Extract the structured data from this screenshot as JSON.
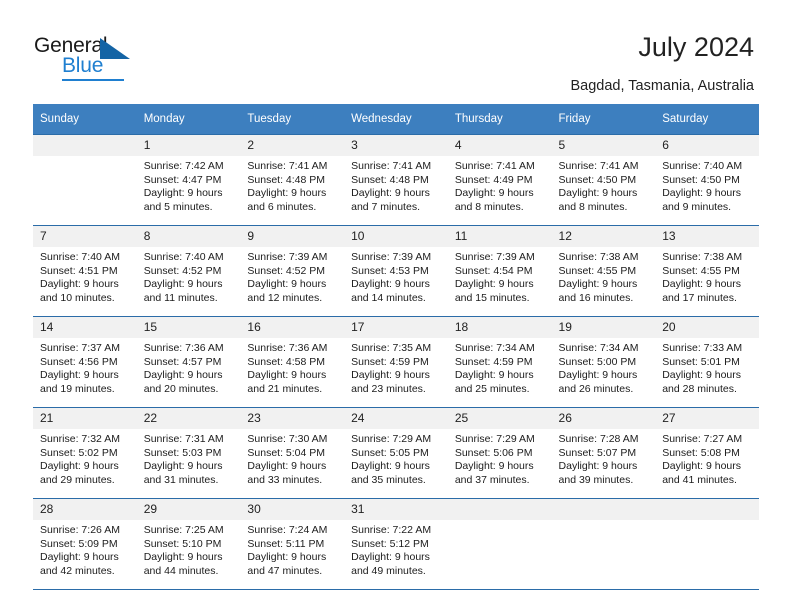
{
  "brand": {
    "name_top": "General",
    "name_bottom": "Blue",
    "accent_color": "#1f7fd0",
    "triangle_color": "#1464a5"
  },
  "header": {
    "title": "July 2024",
    "subtitle": "Bagdad, Tasmania, Australia"
  },
  "calendar": {
    "header_bg": "#3d7fbf",
    "day_band_bg": "#f1f1f1",
    "grid_line_color": "#2b6ca8",
    "weekday_headers": [
      "Sunday",
      "Monday",
      "Tuesday",
      "Wednesday",
      "Thursday",
      "Friday",
      "Saturday"
    ],
    "weeks": [
      [
        {
          "day": "",
          "sunrise": "",
          "sunset": "",
          "daylight_line1": "",
          "daylight_line2": ""
        },
        {
          "day": "1",
          "sunrise": "Sunrise: 7:42 AM",
          "sunset": "Sunset: 4:47 PM",
          "daylight_line1": "Daylight: 9 hours",
          "daylight_line2": "and 5 minutes."
        },
        {
          "day": "2",
          "sunrise": "Sunrise: 7:41 AM",
          "sunset": "Sunset: 4:48 PM",
          "daylight_line1": "Daylight: 9 hours",
          "daylight_line2": "and 6 minutes."
        },
        {
          "day": "3",
          "sunrise": "Sunrise: 7:41 AM",
          "sunset": "Sunset: 4:48 PM",
          "daylight_line1": "Daylight: 9 hours",
          "daylight_line2": "and 7 minutes."
        },
        {
          "day": "4",
          "sunrise": "Sunrise: 7:41 AM",
          "sunset": "Sunset: 4:49 PM",
          "daylight_line1": "Daylight: 9 hours",
          "daylight_line2": "and 8 minutes."
        },
        {
          "day": "5",
          "sunrise": "Sunrise: 7:41 AM",
          "sunset": "Sunset: 4:50 PM",
          "daylight_line1": "Daylight: 9 hours",
          "daylight_line2": "and 8 minutes."
        },
        {
          "day": "6",
          "sunrise": "Sunrise: 7:40 AM",
          "sunset": "Sunset: 4:50 PM",
          "daylight_line1": "Daylight: 9 hours",
          "daylight_line2": "and 9 minutes."
        }
      ],
      [
        {
          "day": "7",
          "sunrise": "Sunrise: 7:40 AM",
          "sunset": "Sunset: 4:51 PM",
          "daylight_line1": "Daylight: 9 hours",
          "daylight_line2": "and 10 minutes."
        },
        {
          "day": "8",
          "sunrise": "Sunrise: 7:40 AM",
          "sunset": "Sunset: 4:52 PM",
          "daylight_line1": "Daylight: 9 hours",
          "daylight_line2": "and 11 minutes."
        },
        {
          "day": "9",
          "sunrise": "Sunrise: 7:39 AM",
          "sunset": "Sunset: 4:52 PM",
          "daylight_line1": "Daylight: 9 hours",
          "daylight_line2": "and 12 minutes."
        },
        {
          "day": "10",
          "sunrise": "Sunrise: 7:39 AM",
          "sunset": "Sunset: 4:53 PM",
          "daylight_line1": "Daylight: 9 hours",
          "daylight_line2": "and 14 minutes."
        },
        {
          "day": "11",
          "sunrise": "Sunrise: 7:39 AM",
          "sunset": "Sunset: 4:54 PM",
          "daylight_line1": "Daylight: 9 hours",
          "daylight_line2": "and 15 minutes."
        },
        {
          "day": "12",
          "sunrise": "Sunrise: 7:38 AM",
          "sunset": "Sunset: 4:55 PM",
          "daylight_line1": "Daylight: 9 hours",
          "daylight_line2": "and 16 minutes."
        },
        {
          "day": "13",
          "sunrise": "Sunrise: 7:38 AM",
          "sunset": "Sunset: 4:55 PM",
          "daylight_line1": "Daylight: 9 hours",
          "daylight_line2": "and 17 minutes."
        }
      ],
      [
        {
          "day": "14",
          "sunrise": "Sunrise: 7:37 AM",
          "sunset": "Sunset: 4:56 PM",
          "daylight_line1": "Daylight: 9 hours",
          "daylight_line2": "and 19 minutes."
        },
        {
          "day": "15",
          "sunrise": "Sunrise: 7:36 AM",
          "sunset": "Sunset: 4:57 PM",
          "daylight_line1": "Daylight: 9 hours",
          "daylight_line2": "and 20 minutes."
        },
        {
          "day": "16",
          "sunrise": "Sunrise: 7:36 AM",
          "sunset": "Sunset: 4:58 PM",
          "daylight_line1": "Daylight: 9 hours",
          "daylight_line2": "and 21 minutes."
        },
        {
          "day": "17",
          "sunrise": "Sunrise: 7:35 AM",
          "sunset": "Sunset: 4:59 PM",
          "daylight_line1": "Daylight: 9 hours",
          "daylight_line2": "and 23 minutes."
        },
        {
          "day": "18",
          "sunrise": "Sunrise: 7:34 AM",
          "sunset": "Sunset: 4:59 PM",
          "daylight_line1": "Daylight: 9 hours",
          "daylight_line2": "and 25 minutes."
        },
        {
          "day": "19",
          "sunrise": "Sunrise: 7:34 AM",
          "sunset": "Sunset: 5:00 PM",
          "daylight_line1": "Daylight: 9 hours",
          "daylight_line2": "and 26 minutes."
        },
        {
          "day": "20",
          "sunrise": "Sunrise: 7:33 AM",
          "sunset": "Sunset: 5:01 PM",
          "daylight_line1": "Daylight: 9 hours",
          "daylight_line2": "and 28 minutes."
        }
      ],
      [
        {
          "day": "21",
          "sunrise": "Sunrise: 7:32 AM",
          "sunset": "Sunset: 5:02 PM",
          "daylight_line1": "Daylight: 9 hours",
          "daylight_line2": "and 29 minutes."
        },
        {
          "day": "22",
          "sunrise": "Sunrise: 7:31 AM",
          "sunset": "Sunset: 5:03 PM",
          "daylight_line1": "Daylight: 9 hours",
          "daylight_line2": "and 31 minutes."
        },
        {
          "day": "23",
          "sunrise": "Sunrise: 7:30 AM",
          "sunset": "Sunset: 5:04 PM",
          "daylight_line1": "Daylight: 9 hours",
          "daylight_line2": "and 33 minutes."
        },
        {
          "day": "24",
          "sunrise": "Sunrise: 7:29 AM",
          "sunset": "Sunset: 5:05 PM",
          "daylight_line1": "Daylight: 9 hours",
          "daylight_line2": "and 35 minutes."
        },
        {
          "day": "25",
          "sunrise": "Sunrise: 7:29 AM",
          "sunset": "Sunset: 5:06 PM",
          "daylight_line1": "Daylight: 9 hours",
          "daylight_line2": "and 37 minutes."
        },
        {
          "day": "26",
          "sunrise": "Sunrise: 7:28 AM",
          "sunset": "Sunset: 5:07 PM",
          "daylight_line1": "Daylight: 9 hours",
          "daylight_line2": "and 39 minutes."
        },
        {
          "day": "27",
          "sunrise": "Sunrise: 7:27 AM",
          "sunset": "Sunset: 5:08 PM",
          "daylight_line1": "Daylight: 9 hours",
          "daylight_line2": "and 41 minutes."
        }
      ],
      [
        {
          "day": "28",
          "sunrise": "Sunrise: 7:26 AM",
          "sunset": "Sunset: 5:09 PM",
          "daylight_line1": "Daylight: 9 hours",
          "daylight_line2": "and 42 minutes."
        },
        {
          "day": "29",
          "sunrise": "Sunrise: 7:25 AM",
          "sunset": "Sunset: 5:10 PM",
          "daylight_line1": "Daylight: 9 hours",
          "daylight_line2": "and 44 minutes."
        },
        {
          "day": "30",
          "sunrise": "Sunrise: 7:24 AM",
          "sunset": "Sunset: 5:11 PM",
          "daylight_line1": "Daylight: 9 hours",
          "daylight_line2": "and 47 minutes."
        },
        {
          "day": "31",
          "sunrise": "Sunrise: 7:22 AM",
          "sunset": "Sunset: 5:12 PM",
          "daylight_line1": "Daylight: 9 hours",
          "daylight_line2": "and 49 minutes."
        },
        {
          "day": "",
          "sunrise": "",
          "sunset": "",
          "daylight_line1": "",
          "daylight_line2": ""
        },
        {
          "day": "",
          "sunrise": "",
          "sunset": "",
          "daylight_line1": "",
          "daylight_line2": ""
        },
        {
          "day": "",
          "sunrise": "",
          "sunset": "",
          "daylight_line1": "",
          "daylight_line2": ""
        }
      ]
    ]
  }
}
